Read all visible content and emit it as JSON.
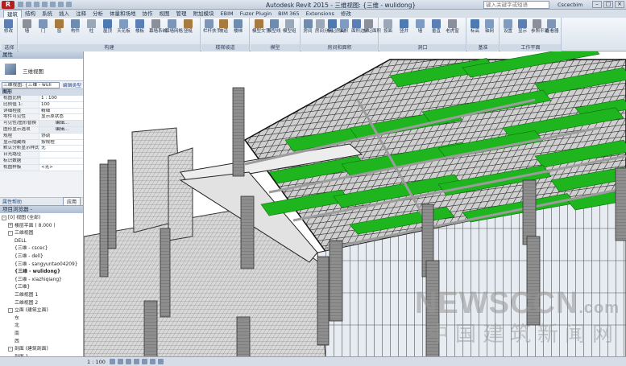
{
  "titlebar": {
    "app_button": "R",
    "title": "Autodesk Revit 2015 - 三维视图: {三维 - wulidong}",
    "search_placeholder": "键入关键字或短语",
    "user": "Cscecbim",
    "controls": [
      "–",
      "□",
      "×"
    ]
  },
  "ribbon_tabs": [
    "建筑",
    "结构",
    "系统",
    "插入",
    "注释",
    "分析",
    "体量和场地",
    "协作",
    "视图",
    "管理",
    "附加模块",
    "EBIM",
    "Fuzor Plugin",
    "BIM 365",
    "Extensions",
    "修改"
  ],
  "ribbon_active_tab": 0,
  "ribbon_groups": [
    {
      "label": "选择",
      "buttons": [
        "修改"
      ]
    },
    {
      "label": "构建",
      "buttons": [
        "墙",
        "门",
        "窗",
        "构件",
        "柱",
        "屋顶",
        "天花板",
        "楼板",
        "幕墙系统",
        "幕墙网格",
        "竖梃"
      ]
    },
    {
      "label": "楼梯坡道",
      "buttons": [
        "栏杆扶手",
        "坡道",
        "楼梯"
      ]
    },
    {
      "label": "模型",
      "buttons": [
        "模型文字",
        "模型线",
        "模型组"
      ]
    },
    {
      "label": "房间和面积",
      "buttons": [
        "房间",
        "房间分隔",
        "标记房间",
        "面积",
        "面积边界",
        "标记面积"
      ]
    },
    {
      "label": "洞口",
      "buttons": [
        "按面",
        "竖井",
        "墙",
        "垂直",
        "老虎窗"
      ]
    },
    {
      "label": "基准",
      "buttons": [
        "标高",
        "轴网"
      ]
    },
    {
      "label": "工作平面",
      "buttons": [
        "设置",
        "显示",
        "参照平面",
        "查看器"
      ]
    }
  ],
  "properties": {
    "header": "属性",
    "type_name": "三维视图",
    "view_selector": "三维视图: {三维 - wuli",
    "edit_type": "编辑类型",
    "category": "图形",
    "rows": [
      {
        "k": "视图比例",
        "v": "1 : 100",
        "btn": false
      },
      {
        "k": "比例值 1:",
        "v": "100",
        "btn": false
      },
      {
        "k": "详细程度",
        "v": "精细",
        "btn": false
      },
      {
        "k": "零件可见性",
        "v": "显示原状态",
        "btn": false
      },
      {
        "k": "可见性/图形替换",
        "v": "编辑...",
        "btn": true
      },
      {
        "k": "图形显示选项",
        "v": "编辑...",
        "btn": true
      },
      {
        "k": "规程",
        "v": "协调",
        "btn": false
      },
      {
        "k": "显示隐藏线",
        "v": "按规程",
        "btn": false
      },
      {
        "k": "默认分析显示样式",
        "v": "无",
        "btn": false
      },
      {
        "k": "日光路径",
        "v": "",
        "btn": false
      },
      {
        "k": "标识数据",
        "v": "",
        "btn": false
      },
      {
        "k": "视图样板",
        "v": "<无>",
        "btn": false
      }
    ],
    "help": "属性帮助",
    "apply": "应用"
  },
  "browser": {
    "header": "项目浏览器 - ",
    "nodes": [
      {
        "text": "[0] 视图 (全部)",
        "indent": 0,
        "toggle": "-",
        "bold": false
      },
      {
        "text": "楼层平面 ( 8.000 )",
        "indent": 1,
        "toggle": "+",
        "bold": false
      },
      {
        "text": "三维视图",
        "indent": 1,
        "toggle": "-",
        "bold": false
      },
      {
        "text": "DELL",
        "indent": 2,
        "toggle": "",
        "bold": false
      },
      {
        "text": "{三维 - cscec}",
        "indent": 2,
        "toggle": "",
        "bold": false
      },
      {
        "text": "{三维 - dell}",
        "indent": 2,
        "toggle": "",
        "bold": false
      },
      {
        "text": "{三维 - sangyuntao04209}",
        "indent": 2,
        "toggle": "",
        "bold": false
      },
      {
        "text": "{三维 - wulidong}",
        "indent": 2,
        "toggle": "",
        "bold": true
      },
      {
        "text": "{三维 - xiazhiqiang}",
        "indent": 2,
        "toggle": "",
        "bold": false
      },
      {
        "text": "{三维}",
        "indent": 2,
        "toggle": "",
        "bold": false
      },
      {
        "text": "三维视图 1",
        "indent": 2,
        "toggle": "",
        "bold": false
      },
      {
        "text": "三维视图 2",
        "indent": 2,
        "toggle": "",
        "bold": false
      },
      {
        "text": "立面 (建筑立面)",
        "indent": 1,
        "toggle": "-",
        "bold": false
      },
      {
        "text": "东",
        "indent": 2,
        "toggle": "",
        "bold": false
      },
      {
        "text": "北",
        "indent": 2,
        "toggle": "",
        "bold": false
      },
      {
        "text": "南",
        "indent": 2,
        "toggle": "",
        "bold": false
      },
      {
        "text": "西",
        "indent": 2,
        "toggle": "",
        "bold": false
      },
      {
        "text": "剖面 (建筑剖面)",
        "indent": 1,
        "toggle": "-",
        "bold": false
      },
      {
        "text": "剖面 1",
        "indent": 2,
        "toggle": "",
        "bold": false
      },
      {
        "text": "剖面 2",
        "indent": 2,
        "toggle": "",
        "bold": false
      }
    ]
  },
  "status": {
    "scale": "1 : 100"
  },
  "watermark": {
    "latin": "NEWSCCN",
    "suffix": ".com",
    "cjk": "中国建筑新闻网"
  },
  "colors": {
    "hvac_green": "#1fb51f",
    "ribbon_bg": "#dbe3ed",
    "app_red": "#b32020"
  }
}
